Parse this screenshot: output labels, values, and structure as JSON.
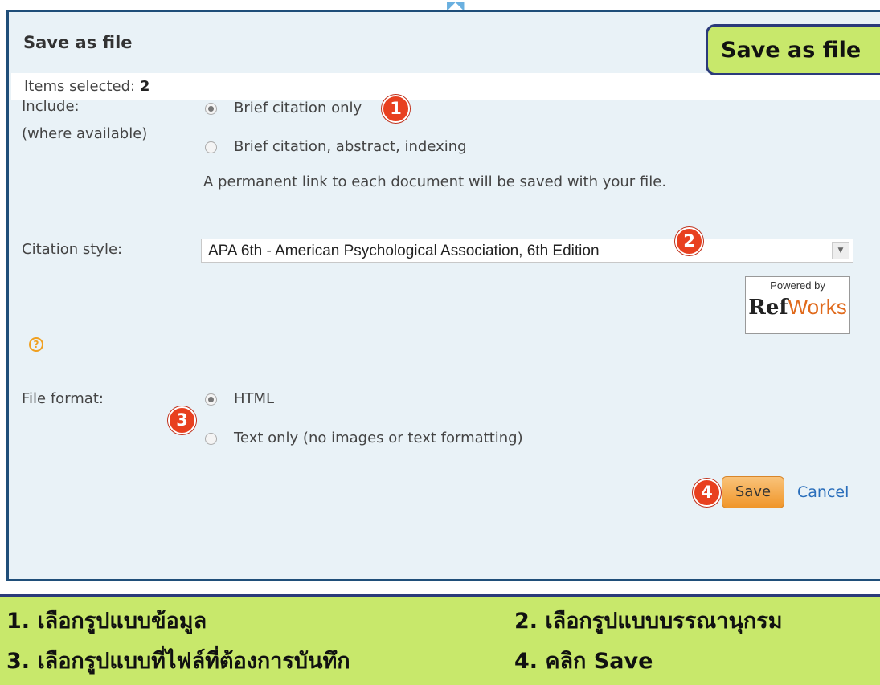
{
  "dialog": {
    "title": "Save as file",
    "items_selected_label": "Items selected:",
    "items_selected_count": "2",
    "include_label": "Include:",
    "include_sublabel": "(where available)",
    "include_options": [
      {
        "label": "Brief citation only",
        "selected": true
      },
      {
        "label": "Brief citation, abstract, indexing",
        "selected": false
      }
    ],
    "permanent_link_note": "A permanent link to each document will be saved with your file.",
    "citation_style_label": "Citation style:",
    "citation_style_value": "APA 6th - American Psychological Association, 6th Edition",
    "refworks_powered": "Powered by",
    "refworks_ref": "Ref",
    "refworks_works": "Works",
    "help_icon": "?",
    "file_format_label": "File format:",
    "file_format_options": [
      {
        "label": "HTML",
        "selected": true
      },
      {
        "label": "Text only (no images or text formatting)",
        "selected": false
      }
    ],
    "save_label": "Save",
    "cancel_label": "Cancel"
  },
  "annotations": {
    "callout": "Save as file",
    "badges": [
      "1",
      "2",
      "3",
      "4"
    ],
    "steps": [
      "1. เลือกรูปแบบข้อมูล",
      "2. เลือกรูปแบบบรรณานุกรม",
      "3. เลือกรูปแบบที่ไฟล์ที่ต้องการบันทึก",
      "4. คลิก Save"
    ]
  },
  "colors": {
    "panel_border": "#1f4e79",
    "panel_bg": "#e9f2f7",
    "badge": "#e8401f",
    "annotation_bg": "#c8e86b",
    "save_button": "#f0962a",
    "link": "#2a6ebb"
  }
}
